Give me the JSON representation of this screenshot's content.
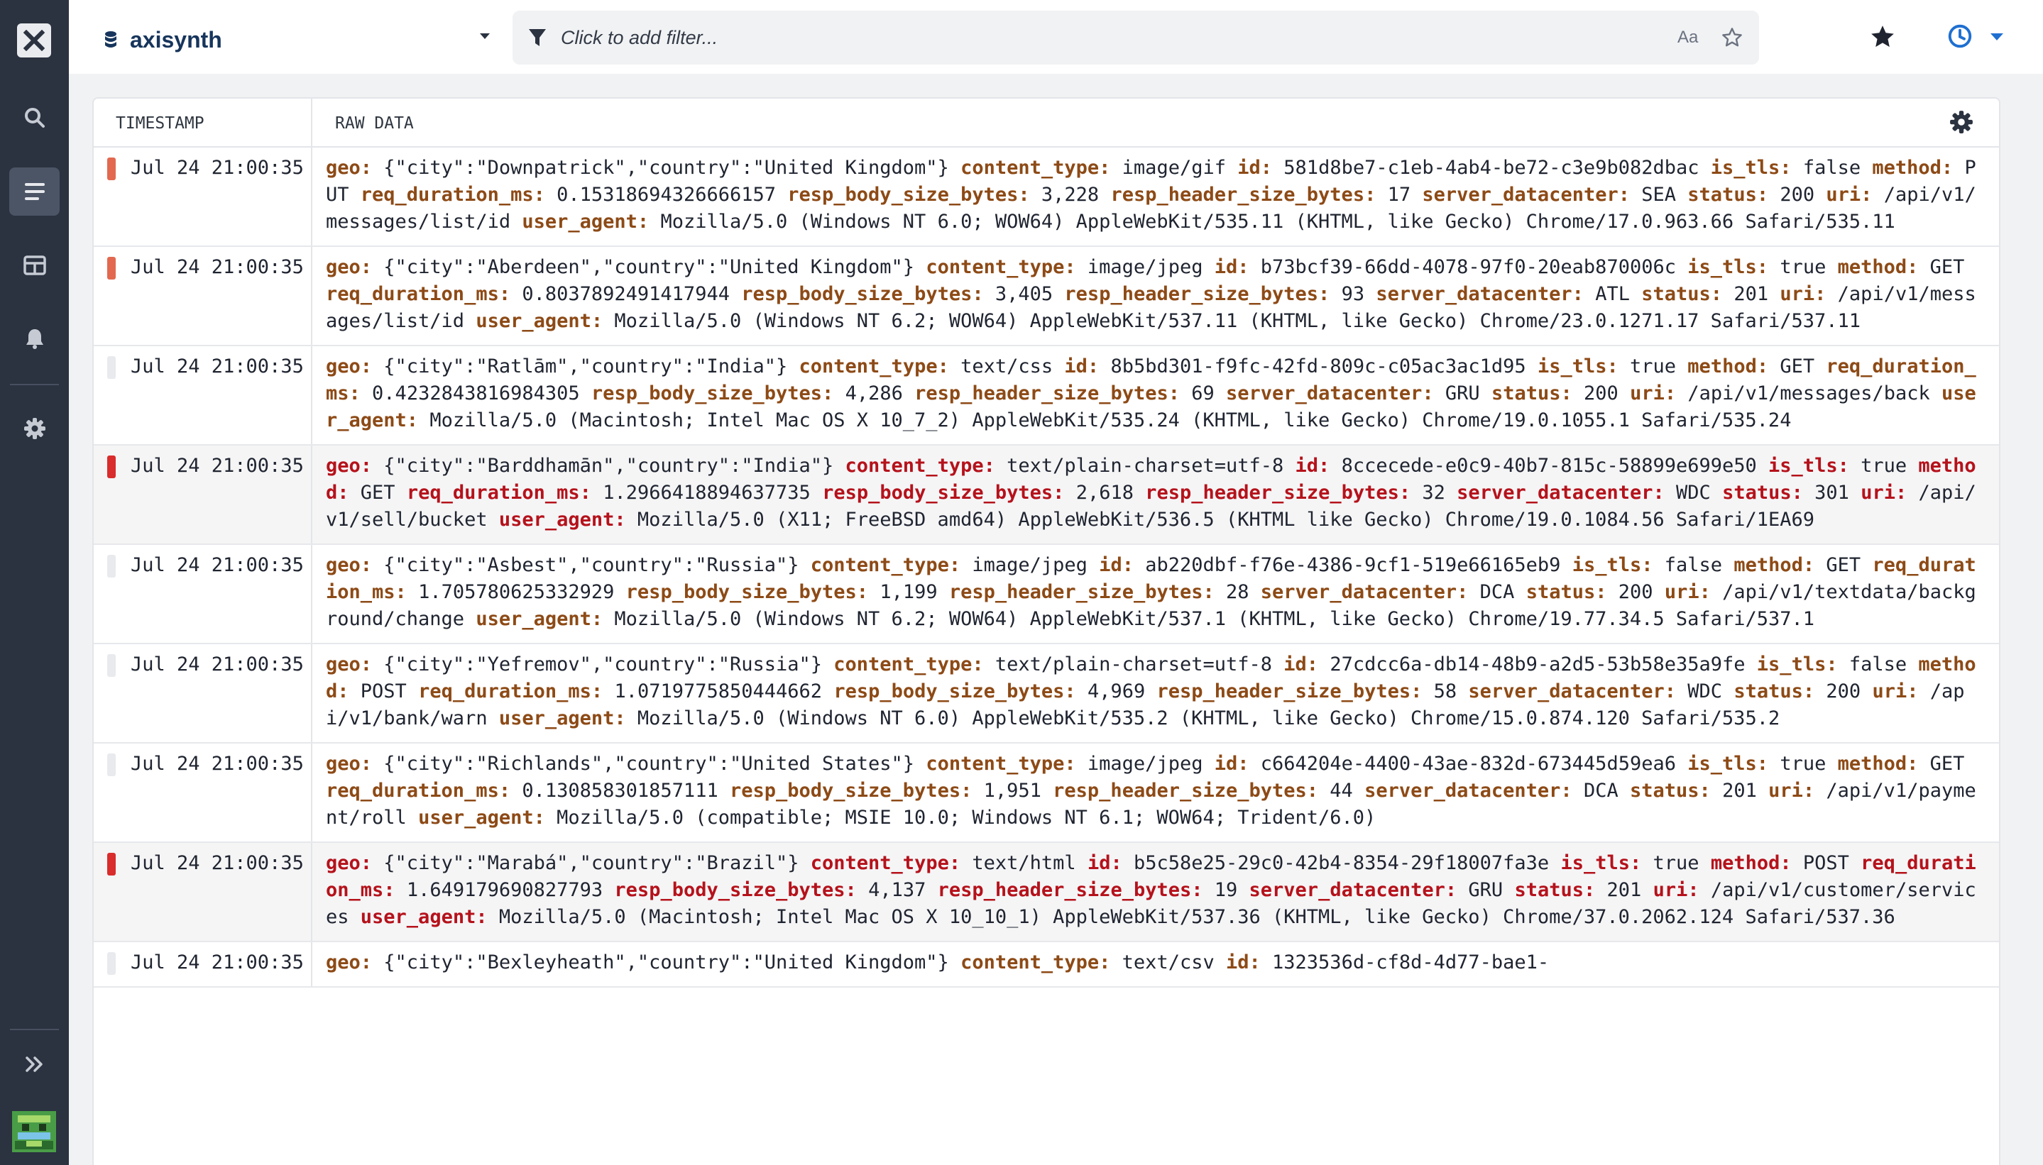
{
  "dataset": {
    "name": "axisynth"
  },
  "filter": {
    "placeholder": "Click to add filter...",
    "case_toggle": "Aa"
  },
  "table": {
    "col_timestamp": "TIMESTAMP",
    "col_raw": "RAW DATA"
  },
  "rows": [
    {
      "severity": "warn",
      "timestamp": "Jul 24 21:00:35",
      "fields": [
        {
          "k": "geo:",
          "v": "{\"city\":\"Downpatrick\",\"country\":\"United Kingdom\"}"
        },
        {
          "k": "content_type:",
          "v": "image/gif"
        },
        {
          "k": "id:",
          "v": "581d8be7-c1eb-4ab4-be72-c3e9b082dbac"
        },
        {
          "k": "is_tls:",
          "v": "false"
        },
        {
          "k": "method:",
          "v": "PUT"
        },
        {
          "k": "req_duration_ms:",
          "v": "0.15318694326666157"
        },
        {
          "k": "resp_body_size_bytes:",
          "v": "3,228"
        },
        {
          "k": "resp_header_size_bytes:",
          "v": "17"
        },
        {
          "k": "server_datacenter:",
          "v": "SEA"
        },
        {
          "k": "status:",
          "v": "200"
        },
        {
          "k": "uri:",
          "v": "/api/v1/messages/list/id"
        },
        {
          "k": "user_agent:",
          "v": "Mozilla/5.0 (Windows NT 6.0; WOW64) AppleWebKit/535.11 (KHTML, like Gecko) Chrome/17.0.963.66 Safari/535.11"
        }
      ]
    },
    {
      "severity": "warn",
      "timestamp": "Jul 24 21:00:35",
      "fields": [
        {
          "k": "geo:",
          "v": "{\"city\":\"Aberdeen\",\"country\":\"United Kingdom\"}"
        },
        {
          "k": "content_type:",
          "v": "image/jpeg"
        },
        {
          "k": "id:",
          "v": "b73bcf39-66dd-4078-97f0-20eab870006c"
        },
        {
          "k": "is_tls:",
          "v": "true"
        },
        {
          "k": "method:",
          "v": "GET"
        },
        {
          "k": "req_duration_ms:",
          "v": "0.8037892491417944"
        },
        {
          "k": "resp_body_size_bytes:",
          "v": "3,405"
        },
        {
          "k": "resp_header_size_bytes:",
          "v": "93"
        },
        {
          "k": "server_datacenter:",
          "v": "ATL"
        },
        {
          "k": "status:",
          "v": "201"
        },
        {
          "k": "uri:",
          "v": "/api/v1/messages/list/id"
        },
        {
          "k": "user_agent:",
          "v": "Mozilla/5.0 (Windows NT 6.2; WOW64) AppleWebKit/537.11 (KHTML, like Gecko) Chrome/23.0.1271.17 Safari/537.11"
        }
      ]
    },
    {
      "severity": "info",
      "timestamp": "Jul 24 21:00:35",
      "fields": [
        {
          "k": "geo:",
          "v": "{\"city\":\"Ratlām\",\"country\":\"India\"}"
        },
        {
          "k": "content_type:",
          "v": "text/css"
        },
        {
          "k": "id:",
          "v": "8b5bd301-f9fc-42fd-809c-c05ac3ac1d95"
        },
        {
          "k": "is_tls:",
          "v": "true"
        },
        {
          "k": "method:",
          "v": "GET"
        },
        {
          "k": "req_duration_ms:",
          "v": "0.4232843816984305"
        },
        {
          "k": "resp_body_size_bytes:",
          "v": "4,286"
        },
        {
          "k": "resp_header_size_bytes:",
          "v": "69"
        },
        {
          "k": "server_datacenter:",
          "v": "GRU"
        },
        {
          "k": "status:",
          "v": "200"
        },
        {
          "k": "uri:",
          "v": "/api/v1/messages/back"
        },
        {
          "k": "user_agent:",
          "v": "Mozilla/5.0 (Macintosh; Intel Mac OS X 10_7_2) AppleWebKit/535.24 (KHTML, like Gecko) Chrome/19.0.1055.1 Safari/535.24"
        }
      ]
    },
    {
      "severity": "err",
      "timestamp": "Jul 24 21:00:35",
      "fields": [
        {
          "k": "geo:",
          "v": "{\"city\":\"Barddhamān\",\"country\":\"India\"}"
        },
        {
          "k": "content_type:",
          "v": "text/plain-charset=utf-8"
        },
        {
          "k": "id:",
          "v": "8ccecede-e0c9-40b7-815c-58899e699e50"
        },
        {
          "k": "is_tls:",
          "v": "true"
        },
        {
          "k": "method:",
          "v": "GET"
        },
        {
          "k": "req_duration_ms:",
          "v": "1.2966418894637735"
        },
        {
          "k": "resp_body_size_bytes:",
          "v": "2,618"
        },
        {
          "k": "resp_header_size_bytes:",
          "v": "32"
        },
        {
          "k": "server_datacenter:",
          "v": "WDC"
        },
        {
          "k": "status:",
          "v": "301"
        },
        {
          "k": "uri:",
          "v": "/api/v1/sell/bucket"
        },
        {
          "k": "user_agent:",
          "v": "Mozilla/5.0 (X11; FreeBSD amd64) AppleWebKit/536.5 (KHTML like Gecko) Chrome/19.0.1084.56 Safari/1EA69"
        }
      ]
    },
    {
      "severity": "info",
      "timestamp": "Jul 24 21:00:35",
      "fields": [
        {
          "k": "geo:",
          "v": "{\"city\":\"Asbest\",\"country\":\"Russia\"}"
        },
        {
          "k": "content_type:",
          "v": "image/jpeg"
        },
        {
          "k": "id:",
          "v": "ab220dbf-f76e-4386-9cf1-519e66165eb9"
        },
        {
          "k": "is_tls:",
          "v": "false"
        },
        {
          "k": "method:",
          "v": "GET"
        },
        {
          "k": "req_duration_ms:",
          "v": "1.705780625332929"
        },
        {
          "k": "resp_body_size_bytes:",
          "v": "1,199"
        },
        {
          "k": "resp_header_size_bytes:",
          "v": "28"
        },
        {
          "k": "server_datacenter:",
          "v": "DCA"
        },
        {
          "k": "status:",
          "v": "200"
        },
        {
          "k": "uri:",
          "v": "/api/v1/textdata/background/change"
        },
        {
          "k": "user_agent:",
          "v": "Mozilla/5.0 (Windows NT 6.2; WOW64) AppleWebKit/537.1 (KHTML, like Gecko) Chrome/19.77.34.5 Safari/537.1"
        }
      ]
    },
    {
      "severity": "info",
      "timestamp": "Jul 24 21:00:35",
      "fields": [
        {
          "k": "geo:",
          "v": "{\"city\":\"Yefremov\",\"country\":\"Russia\"}"
        },
        {
          "k": "content_type:",
          "v": "text/plain-charset=utf-8"
        },
        {
          "k": "id:",
          "v": "27cdcc6a-db14-48b9-a2d5-53b58e35a9fe"
        },
        {
          "k": "is_tls:",
          "v": "false"
        },
        {
          "k": "method:",
          "v": "POST"
        },
        {
          "k": "req_duration_ms:",
          "v": "1.0719775850444662"
        },
        {
          "k": "resp_body_size_bytes:",
          "v": "4,969"
        },
        {
          "k": "resp_header_size_bytes:",
          "v": "58"
        },
        {
          "k": "server_datacenter:",
          "v": "WDC"
        },
        {
          "k": "status:",
          "v": "200"
        },
        {
          "k": "uri:",
          "v": "/api/v1/bank/warn"
        },
        {
          "k": "user_agent:",
          "v": "Mozilla/5.0 (Windows NT 6.0) AppleWebKit/535.2 (KHTML, like Gecko) Chrome/15.0.874.120 Safari/535.2"
        }
      ]
    },
    {
      "severity": "info",
      "timestamp": "Jul 24 21:00:35",
      "fields": [
        {
          "k": "geo:",
          "v": "{\"city\":\"Richlands\",\"country\":\"United States\"}"
        },
        {
          "k": "content_type:",
          "v": "image/jpeg"
        },
        {
          "k": "id:",
          "v": "c664204e-4400-43ae-832d-673445d59ea6"
        },
        {
          "k": "is_tls:",
          "v": "true"
        },
        {
          "k": "method:",
          "v": "GET"
        },
        {
          "k": "req_duration_ms:",
          "v": "0.130858301857111"
        },
        {
          "k": "resp_body_size_bytes:",
          "v": "1,951"
        },
        {
          "k": "resp_header_size_bytes:",
          "v": "44"
        },
        {
          "k": "server_datacenter:",
          "v": "DCA"
        },
        {
          "k": "status:",
          "v": "201"
        },
        {
          "k": "uri:",
          "v": "/api/v1/payment/roll"
        },
        {
          "k": "user_agent:",
          "v": "Mozilla/5.0 (compatible; MSIE 10.0; Windows NT 6.1; WOW64; Trident/6.0)"
        }
      ]
    },
    {
      "severity": "err",
      "timestamp": "Jul 24 21:00:35",
      "fields": [
        {
          "k": "geo:",
          "v": "{\"city\":\"Marabá\",\"country\":\"Brazil\"}"
        },
        {
          "k": "content_type:",
          "v": "text/html"
        },
        {
          "k": "id:",
          "v": "b5c58e25-29c0-42b4-8354-29f18007fa3e"
        },
        {
          "k": "is_tls:",
          "v": "true"
        },
        {
          "k": "method:",
          "v": "POST"
        },
        {
          "k": "req_duration_ms:",
          "v": "1.649179690827793"
        },
        {
          "k": "resp_body_size_bytes:",
          "v": "4,137"
        },
        {
          "k": "resp_header_size_bytes:",
          "v": "19"
        },
        {
          "k": "server_datacenter:",
          "v": "GRU"
        },
        {
          "k": "status:",
          "v": "201"
        },
        {
          "k": "uri:",
          "v": "/api/v1/customer/services"
        },
        {
          "k": "user_agent:",
          "v": "Mozilla/5.0 (Macintosh; Intel Mac OS X 10_10_1) AppleWebKit/537.36 (KHTML, like Gecko) Chrome/37.0.2062.124 Safari/537.36"
        }
      ]
    },
    {
      "severity": "info",
      "timestamp": "Jul 24 21:00:35",
      "fields": [
        {
          "k": "geo:",
          "v": "{\"city\":\"Bexleyheath\",\"country\":\"United Kingdom\"}"
        },
        {
          "k": "content_type:",
          "v": "text/csv"
        },
        {
          "k": "id:",
          "v": "1323536d-cf8d-4d77-bae1-"
        }
      ]
    }
  ]
}
